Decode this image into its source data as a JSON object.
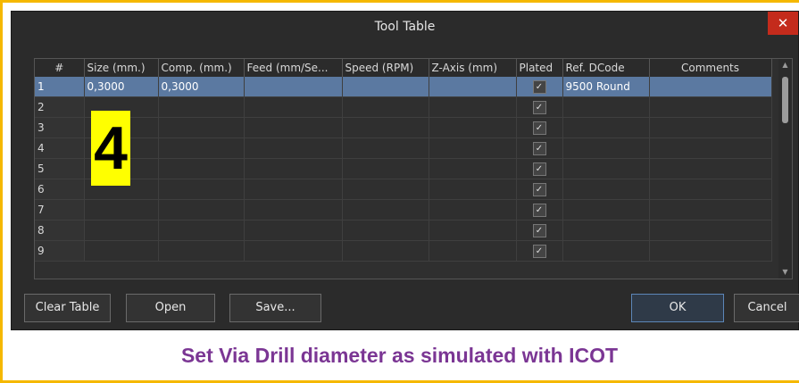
{
  "dialog": {
    "title": "Tool Table",
    "close_glyph": "✕"
  },
  "table": {
    "headers": [
      "#",
      "Size (mm.)",
      "Comp. (mm.)",
      "Feed (mm/Se...",
      "Speed (RPM)",
      "Z-Axis (mm)",
      "Plated",
      "Ref. DCode",
      "Comments"
    ],
    "rows": [
      {
        "num": "1",
        "size": "0,3000",
        "comp": "0,3000",
        "feed": "",
        "speed": "",
        "zaxis": "",
        "plated": true,
        "dcode": "9500  Round",
        "comments": "",
        "selected": true
      },
      {
        "num": "2",
        "size": "",
        "comp": "",
        "feed": "",
        "speed": "",
        "zaxis": "",
        "plated": true,
        "dcode": "",
        "comments": ""
      },
      {
        "num": "3",
        "size": "",
        "comp": "",
        "feed": "",
        "speed": "",
        "zaxis": "",
        "plated": true,
        "dcode": "",
        "comments": ""
      },
      {
        "num": "4",
        "size": "",
        "comp": "",
        "feed": "",
        "speed": "",
        "zaxis": "",
        "plated": true,
        "dcode": "",
        "comments": ""
      },
      {
        "num": "5",
        "size": "",
        "comp": "",
        "feed": "",
        "speed": "",
        "zaxis": "",
        "plated": true,
        "dcode": "",
        "comments": ""
      },
      {
        "num": "6",
        "size": "",
        "comp": "",
        "feed": "",
        "speed": "",
        "zaxis": "",
        "plated": true,
        "dcode": "",
        "comments": ""
      },
      {
        "num": "7",
        "size": "",
        "comp": "",
        "feed": "",
        "speed": "",
        "zaxis": "",
        "plated": true,
        "dcode": "",
        "comments": ""
      },
      {
        "num": "8",
        "size": "",
        "comp": "",
        "feed": "",
        "speed": "",
        "zaxis": "",
        "plated": true,
        "dcode": "",
        "comments": ""
      },
      {
        "num": "9",
        "size": "",
        "comp": "",
        "feed": "",
        "speed": "",
        "zaxis": "",
        "plated": true,
        "dcode": "",
        "comments": ""
      }
    ],
    "check_glyph": "✓"
  },
  "buttons": {
    "clear_table": "Clear Table",
    "open": "Open",
    "save": "Save...",
    "ok": "OK",
    "cancel": "Cancel"
  },
  "annotation": {
    "step_number": "4"
  },
  "caption": "Set Via Drill diameter as simulated with ICOT",
  "colors": {
    "frame": "#f5b800",
    "selected_row": "#5b79a1",
    "caption": "#7b3694",
    "step_label_bg": "#ffff00",
    "close_button": "#c42b1c"
  }
}
